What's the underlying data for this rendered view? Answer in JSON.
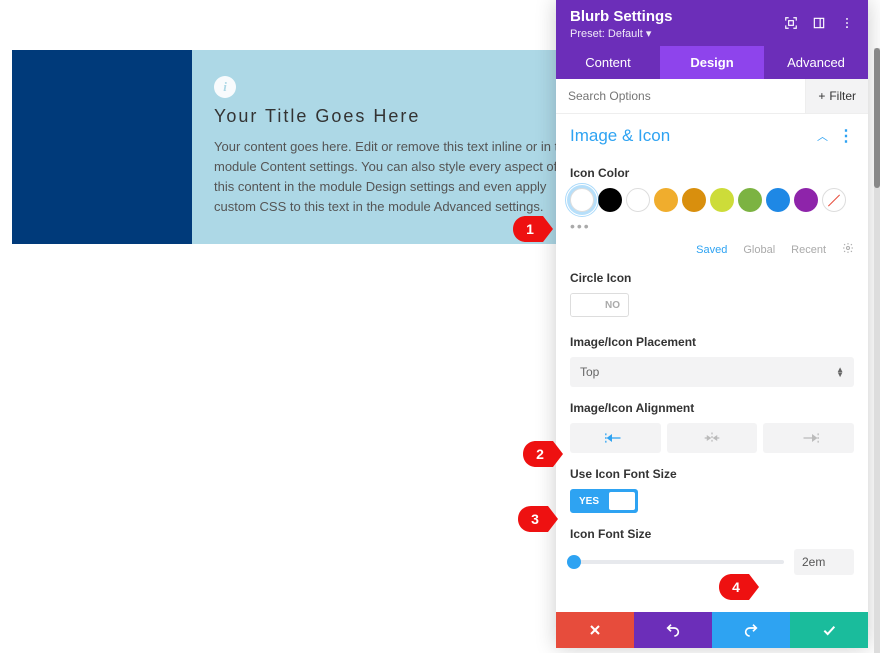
{
  "canvas": {
    "title": "Your Title Goes Here",
    "body": "Your content goes here. Edit or remove this text inline or in the module Content settings. You can also style every aspect of this content in the module Design settings and even apply custom CSS to this text in the module Advanced settings."
  },
  "panel": {
    "title": "Blurb Settings",
    "preset": "Preset: Default",
    "tabs": {
      "content": "Content",
      "design": "Design",
      "advanced": "Advanced",
      "active": "design"
    },
    "search_placeholder": "Search Options",
    "filter_label": "Filter",
    "section": {
      "title": "Image & Icon"
    },
    "icon_color": {
      "label": "Icon Color",
      "swatches": [
        {
          "name": "swatch-white-selected",
          "color": "#ffffff",
          "outline": true,
          "selected": true
        },
        {
          "name": "swatch-black",
          "color": "#000000"
        },
        {
          "name": "swatch-white",
          "color": "#ffffff",
          "outline": true
        },
        {
          "name": "swatch-orange",
          "color": "#f0ad2d"
        },
        {
          "name": "swatch-darkorange",
          "color": "#d98f0d"
        },
        {
          "name": "swatch-yellowgreen",
          "color": "#cddc39"
        },
        {
          "name": "swatch-green",
          "color": "#7cb342"
        },
        {
          "name": "swatch-blue",
          "color": "#1e88e5"
        },
        {
          "name": "swatch-purple",
          "color": "#8e24aa"
        },
        {
          "name": "swatch-none",
          "nocolor": true
        }
      ],
      "tabs": {
        "saved": "Saved",
        "global": "Global",
        "recent": "Recent"
      }
    },
    "circle_icon": {
      "label": "Circle Icon",
      "value": "NO",
      "on": false
    },
    "placement": {
      "label": "Image/Icon Placement",
      "value": "Top"
    },
    "alignment": {
      "label": "Image/Icon Alignment",
      "active": "left"
    },
    "use_icon_font_size": {
      "label": "Use Icon Font Size",
      "value": "YES",
      "on": true
    },
    "icon_font_size": {
      "label": "Icon Font Size",
      "value": "2em",
      "pct": 2
    }
  },
  "callouts": {
    "c1": "1",
    "c2": "2",
    "c3": "3",
    "c4": "4"
  }
}
